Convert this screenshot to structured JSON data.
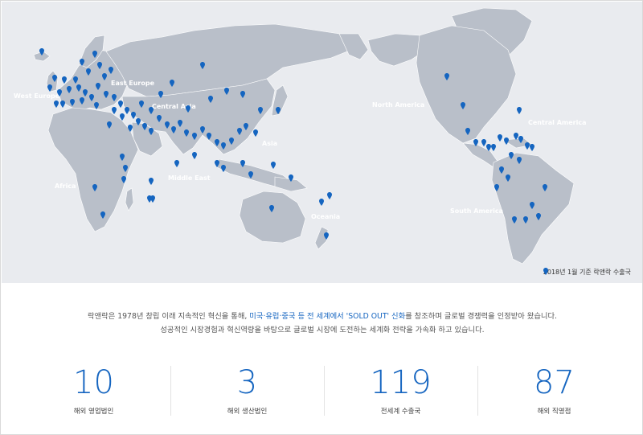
{
  "map": {
    "regions": {
      "west_europe": "West Europe",
      "east_europe": "East Europe",
      "central_asia": "Central Asia",
      "africa": "Africa",
      "middle_east": "Middle East",
      "asia": "Asia",
      "oceania": "Oceania",
      "north_america": "North America",
      "central_america": "Central America",
      "south_america": "South America"
    },
    "legend": "2018년 1월 기준 락앤락 수출국",
    "pin_color": "#1565c0"
  },
  "intro": {
    "line1_pre": "락앤락은 1978년 창립 이래 지속적인 혁신을 통해, ",
    "line1_highlight": "미국·유럽·중국 등 전 세계에서 'SOLD OUT' 신화",
    "line1_post": "를 창조하며 글로벌 경쟁력을 인정받아 왔습니다.",
    "line2": "성공적인 시장경험과 혁신역량을 바탕으로 글로벌 시장에 도전하는 세계화 전략을 가속화 하고 있습니다."
  },
  "stats": [
    {
      "value": "10",
      "label": "해외 영업법인"
    },
    {
      "value": "3",
      "label": "해외 생산법인"
    },
    {
      "value": "119",
      "label": "전세계 수출국"
    },
    {
      "value": "87",
      "label": "해외 직영점"
    }
  ]
}
